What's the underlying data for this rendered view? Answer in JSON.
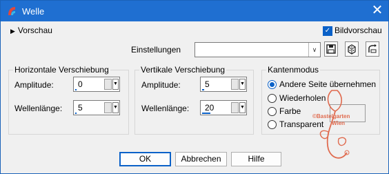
{
  "window": {
    "title": "Welle",
    "close_glyph": "✕"
  },
  "preview": {
    "label": "Vorschau",
    "glyph": "▶"
  },
  "bildvorschau": {
    "label": "Bildvorschau",
    "checked": true
  },
  "settings": {
    "label": "Einstellungen",
    "value": ""
  },
  "horizontal": {
    "title": "Horizontale Verschiebung",
    "amplitude_label": "Amplitude:",
    "amplitude_value": "0",
    "wavelength_label": "Wellenlänge:",
    "wavelength_value": "5"
  },
  "vertical": {
    "title": "Vertikale Verschiebung",
    "amplitude_label": "Amplitude:",
    "amplitude_value": "5",
    "wavelength_label": "Wellenlänge:",
    "wavelength_value": "20"
  },
  "edge_mode": {
    "title": "Kantenmodus",
    "options": [
      "Andere Seite übernehmen",
      "Wiederholen",
      "Farbe",
      "Transparent"
    ],
    "selected": "Andere Seite übernehmen"
  },
  "buttons": {
    "ok": "OK",
    "cancel": "Abbrechen",
    "help": "Hilfe"
  },
  "watermark": {
    "line1": "©Bastelgarten",
    "line2": "Wien"
  },
  "colors": {
    "titlebar": "#1f6fd1",
    "accent": "#0a61c8",
    "watermark": "#e06b4f"
  }
}
